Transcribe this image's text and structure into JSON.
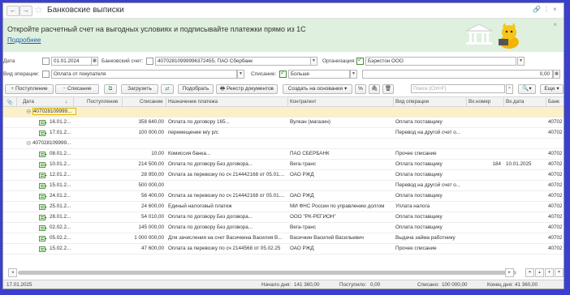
{
  "window": {
    "title": "Банковские выписки"
  },
  "banner": {
    "text": "Откройте расчетный счет на выгодных условиях и подписывайте платежки прямо из 1С",
    "link": "Подробнее",
    "close": "×"
  },
  "filters": {
    "date_label": "Дата",
    "date_value": "01.01.2024",
    "bank_account_label": "Банковский счет:",
    "bank_account_value": "40702810999996372455, ПАО Сбербанк",
    "org_label": "Организация:",
    "org_value": "Бэристон ООО",
    "op_type_label": "Вид операции:",
    "op_type_value": "Оплата от покупателя",
    "writeoff_label": "Списание:",
    "writeoff_value": "Больше",
    "amount_value": "0,00"
  },
  "toolbar": {
    "incoming": "Поступление",
    "writeoff": "Списание",
    "load": "Загрузить",
    "pick": "Подобрать",
    "registry": "Реестр документов",
    "create_based": "Создать на основании",
    "search_placeholder": "Поиск (Ctrl+F)",
    "more": "Еще"
  },
  "columns": [
    "Дата",
    "Поступление",
    "Списание",
    "Назначение платежа",
    "Контрагент",
    "Вид операции",
    "Вх.номер",
    "Вх.дата",
    "Банк"
  ],
  "rows": [
    {
      "type": "group",
      "date": "407028109999...",
      "highlight": true
    },
    {
      "type": "doc",
      "date": "16.01.2...",
      "in": "",
      "out": "358 640,00",
      "purpose": "Оплата по договору 165...",
      "counterparty": "Вулкан (магазин)",
      "op": "Оплата поставщику",
      "num": "",
      "vdate": "",
      "bank": "40702"
    },
    {
      "type": "doc",
      "date": "17.01.2...",
      "in": "",
      "out": "100 000,00",
      "purpose": "перемещение м/у р/с",
      "counterparty": "",
      "op": "Перевод на другой счет о...",
      "num": "",
      "vdate": "",
      "bank": "40702"
    },
    {
      "type": "group",
      "date": "407028109999...",
      "highlight": false
    },
    {
      "type": "doc",
      "date": "08.01.2...",
      "in": "",
      "out": "10,00",
      "purpose": "Комиссия банка...",
      "counterparty": "ПАО СБЕРБАНК",
      "op": "Прочее списание",
      "num": "",
      "vdate": "",
      "bank": "40702"
    },
    {
      "type": "doc",
      "date": "10.01.2...",
      "in": "",
      "out": "214 500,00",
      "purpose": "Оплата по договору Без договора...",
      "counterparty": "Вега-транс",
      "op": "Оплата поставщику",
      "num": "184",
      "vdate": "10.01.2025",
      "bank": "40702"
    },
    {
      "type": "doc",
      "date": "12.01.2...",
      "in": "",
      "out": "28 950,00",
      "purpose": "Оплата за перевозку по сч 214442168 от 05.01....",
      "counterparty": "ОАО РЖД",
      "op": "Оплата поставщику",
      "num": "",
      "vdate": "",
      "bank": "40702"
    },
    {
      "type": "doc",
      "date": "15.01.2...",
      "in": "",
      "out": "500 000,00",
      "purpose": "",
      "counterparty": "",
      "op": "Перевод на другой счет о...",
      "num": "",
      "vdate": "",
      "bank": "40702"
    },
    {
      "type": "doc",
      "date": "24.01.2...",
      "in": "",
      "out": "56 400,00",
      "purpose": "Оплата за перевозку по сч 214442168 от 05.01....",
      "counterparty": "ОАО РЖД",
      "op": "Оплата поставщику",
      "num": "",
      "vdate": "",
      "bank": "40702"
    },
    {
      "type": "doc",
      "date": "25.01.2...",
      "in": "",
      "out": "24 600,00",
      "purpose": "Единый налоговый платеж",
      "counterparty": "МИ ФНС России по управлению долгом",
      "op": "Уплата налога",
      "num": "",
      "vdate": "",
      "bank": "40702"
    },
    {
      "type": "doc",
      "date": "28.01.2...",
      "in": "",
      "out": "54 010,00",
      "purpose": "Оплата по договору Без договора...",
      "counterparty": "ООО \"РК-РЕГИОН\"",
      "op": "Оплата поставщику",
      "num": "",
      "vdate": "",
      "bank": "40702"
    },
    {
      "type": "doc",
      "date": "02.02.2...",
      "in": "",
      "out": "145 000,00",
      "purpose": "Оплата по договору Без договора...",
      "counterparty": "Вега-транс",
      "op": "Оплата поставщику",
      "num": "",
      "vdate": "",
      "bank": "40702"
    },
    {
      "type": "doc",
      "date": "05.02.2...",
      "in": "",
      "out": "1 000 000,00",
      "purpose": "Для зачисления на счет Васичкина Василия В...",
      "counterparty": "Васичкин Василий Васильевич",
      "op": "Выдача займа работнику",
      "num": "",
      "vdate": "",
      "bank": "40702"
    },
    {
      "type": "doc",
      "date": "15.02.2...",
      "in": "",
      "out": "47 600,00",
      "purpose": "Оплата за перевозку по сч 2144568 от 05.02.25",
      "counterparty": "ОАО РЖД",
      "op": "Прочее списание",
      "num": "",
      "vdate": "",
      "bank": "40702"
    }
  ],
  "status": {
    "date": "17.01.2025",
    "start_label": "Начало дня:",
    "start_value": "141 360,00",
    "in_label": "Поступило:",
    "in_value": "0,00",
    "out_label": "Списано:",
    "out_value": "100 000,00",
    "end_label": "Конец дня:",
    "end_value": "41 360,00"
  }
}
